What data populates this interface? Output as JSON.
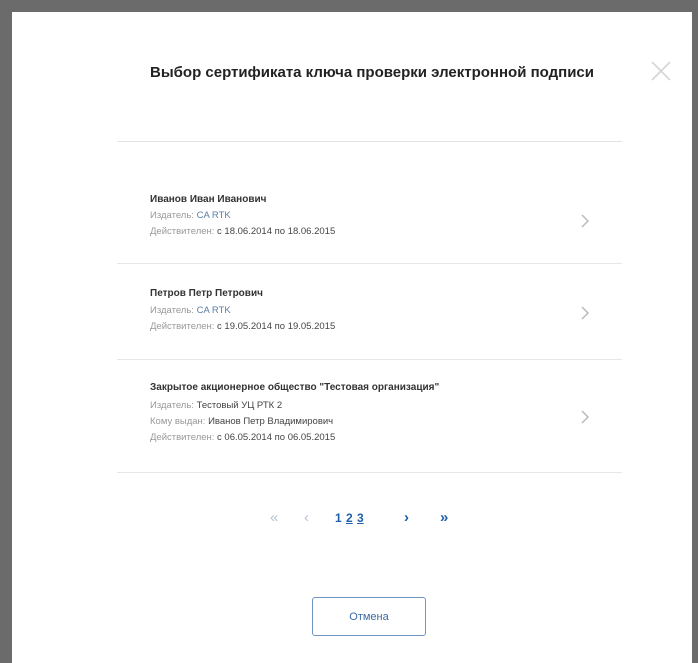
{
  "dialog": {
    "title": "Выбор сертификата ключа проверки электронной подписи",
    "cancel_label": "Отмена"
  },
  "certificates": [
    {
      "name": "Иванов Иван Иванович",
      "issuer_label": "Издатель:",
      "issuer": "CA RTK",
      "validity_label": "Действителен:",
      "validity": "с 18.06.2014 по 18.06.2015"
    },
    {
      "name": "Петров Петр Петрович",
      "issuer_label": "Издатель:",
      "issuer": "CA RTK",
      "validity_label": "Действителен:",
      "validity": "с 19.05.2014 по 19.05.2015"
    },
    {
      "name": "Закрытое акционерное общество \"Тестовая организация\"",
      "issuer_label": "Издатель:",
      "issuer": "Тестовый УЦ РТК 2",
      "issued_to_label": "Кому выдан:",
      "issued_to": "Иванов Петр Владимирович",
      "validity_label": "Действителен:",
      "validity": "с 06.05.2014 по 06.05.2015"
    }
  ],
  "pagination": {
    "first": "«",
    "prev": "‹",
    "pages": [
      "1",
      "2",
      "3"
    ],
    "next": "›",
    "last": "»"
  },
  "icons": {
    "close": "close-icon",
    "chevron": "chevron-right-icon"
  }
}
